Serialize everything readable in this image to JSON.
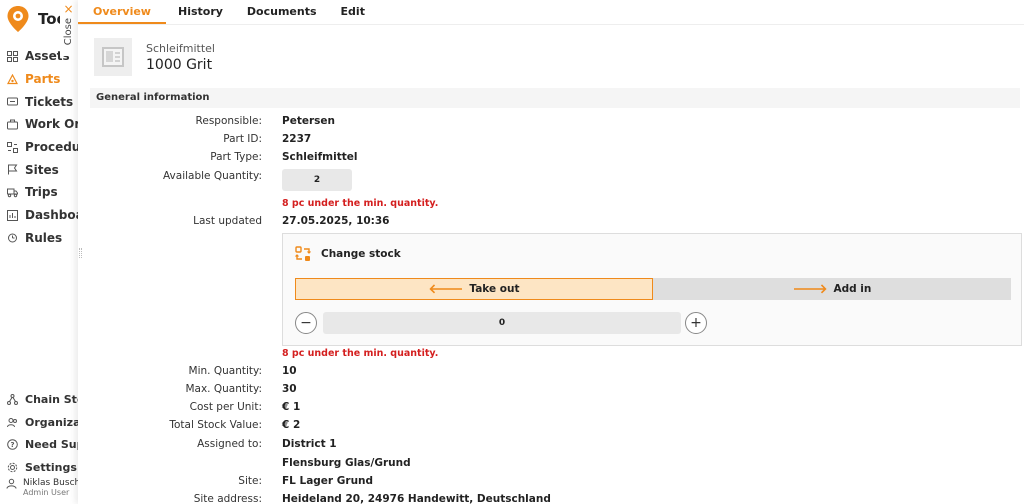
{
  "app": {
    "brand": "Too",
    "nav": [
      {
        "label": "Assets",
        "icon": "grid-icon",
        "active": false
      },
      {
        "label": "Parts",
        "icon": "parts-icon",
        "active": true
      },
      {
        "label": "Tickets",
        "icon": "ticket-icon",
        "active": false
      },
      {
        "label": "Work Ord",
        "icon": "briefcase-icon",
        "active": false
      },
      {
        "label": "Procedur",
        "icon": "procedure-icon",
        "active": false
      },
      {
        "label": "Sites",
        "icon": "flag-icon",
        "active": false
      },
      {
        "label": "Trips",
        "icon": "truck-icon",
        "active": false
      },
      {
        "label": "Dashboar",
        "icon": "chart-icon",
        "active": false
      },
      {
        "label": "Rules",
        "icon": "alarm-icon",
        "active": false
      }
    ],
    "nav_bottom": [
      {
        "label": "Chain Stor",
        "icon": "network-icon"
      },
      {
        "label": "Organizati",
        "icon": "people-icon"
      },
      {
        "label": "Need Supp",
        "icon": "help-icon"
      },
      {
        "label": "Settings",
        "icon": "gear-icon"
      }
    ],
    "user": {
      "name": "Niklas Busch",
      "role": "Admin User"
    },
    "accent": "#ef8a1b"
  },
  "close": {
    "label": "Close",
    "icon": "×"
  },
  "tabs": [
    {
      "label": "Overview",
      "active": true
    },
    {
      "label": "History",
      "active": false
    },
    {
      "label": "Documents",
      "active": false
    },
    {
      "label": "Edit",
      "active": false
    }
  ],
  "part": {
    "category": "Schleifmittel",
    "name": "1000 Grit"
  },
  "general": {
    "section_title": "General information",
    "responsible_label": "Responsible:",
    "responsible": "Petersen",
    "part_id_label": "Part ID:",
    "part_id": "2237",
    "part_type_label": "Part Type:",
    "part_type": "Schleifmittel",
    "available_label": "Available Quantity:",
    "available": "2",
    "warning": "8 pc under the min. quantity.",
    "last_updated_label": "Last updated",
    "last_updated": "27.05.2025, 10:36",
    "min_label": "Min. Quantity:",
    "min": "10",
    "max_label": "Max. Quantity:",
    "max": "30",
    "cost_label": "Cost per Unit:",
    "cost": "€ 1",
    "total_label": "Total Stock Value:",
    "total": "€ 2",
    "assigned_label": "Assigned to:",
    "assigned": "District 1",
    "assigned2": "Flensburg Glas/Grund",
    "site_label": "Site:",
    "site": "FL Lager Grund",
    "address_label": "Site address:",
    "address": "Heideland 20, 24976 Handewitt, Deutschland"
  },
  "stock": {
    "title": "Change stock",
    "take_out": "Take out",
    "add_in": "Add in",
    "amount": "0",
    "minus": "−",
    "plus": "+",
    "warning": "8 pc under the min. quantity."
  }
}
